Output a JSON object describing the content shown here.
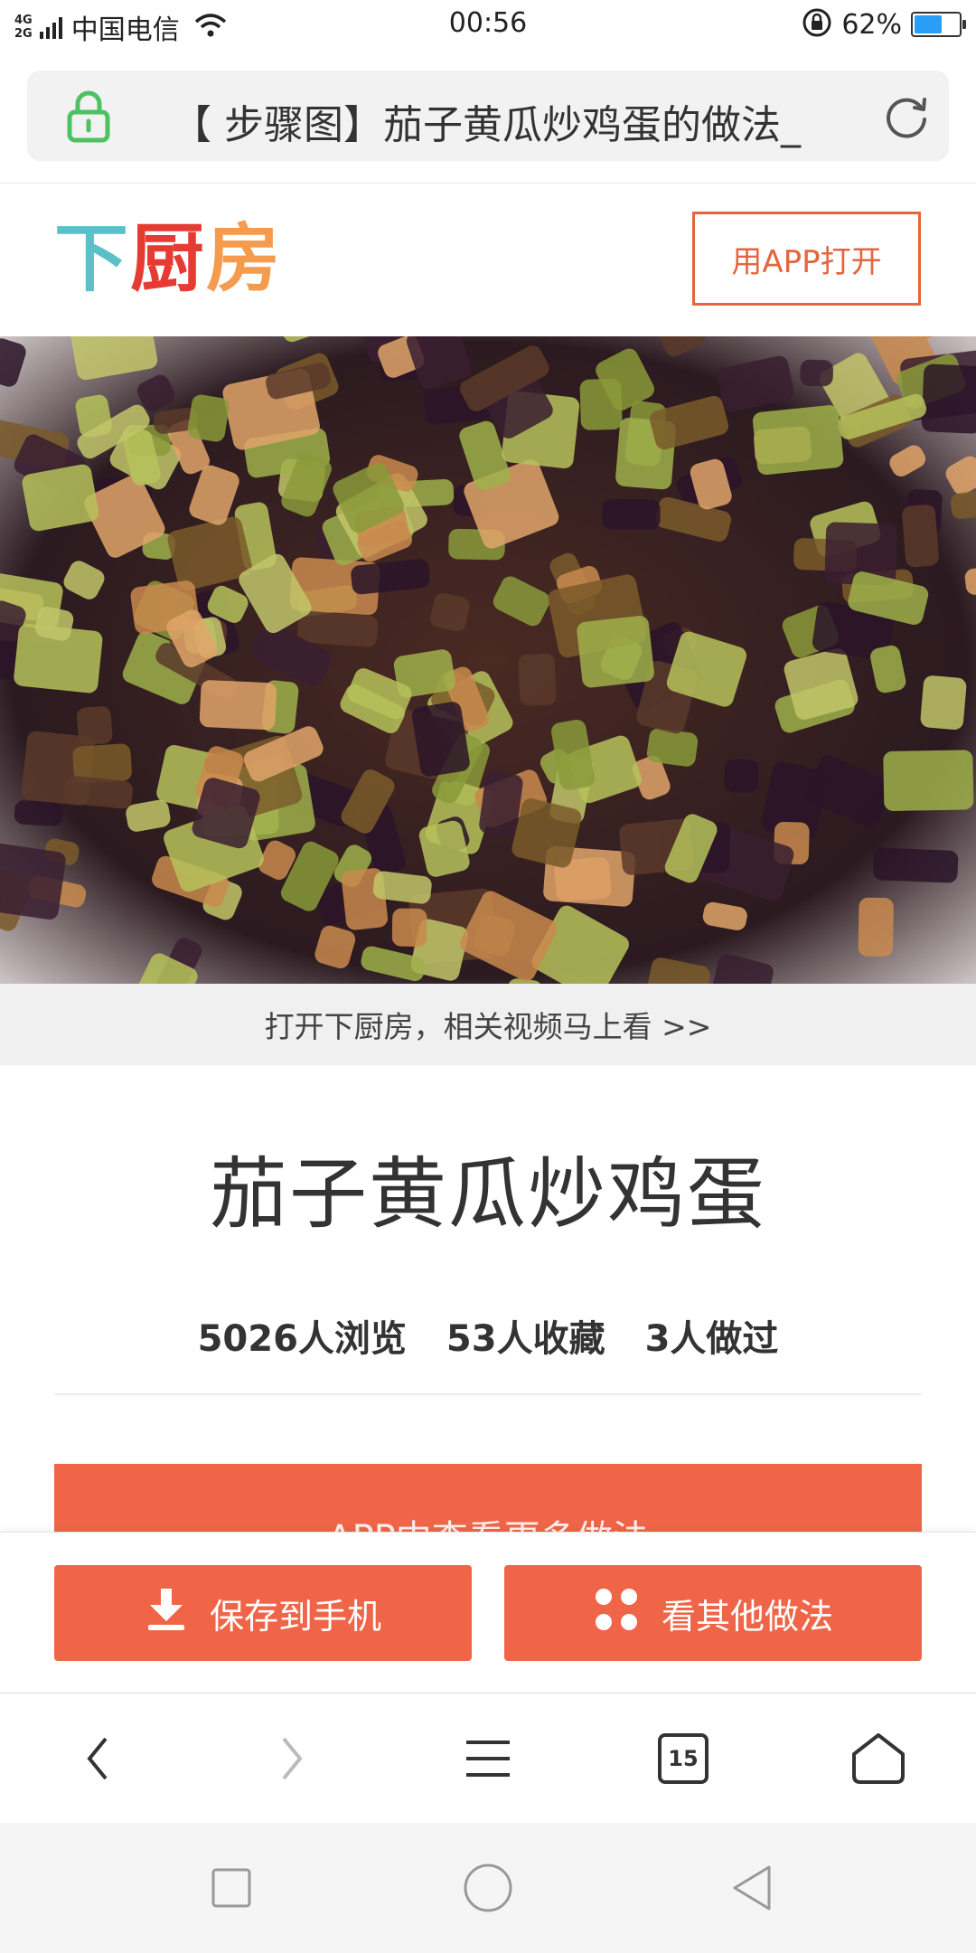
{
  "status_bar": {
    "network_top": "4G",
    "network_bottom": "2G",
    "carrier": "中国电信",
    "time": "00:56",
    "battery_percent": "62%",
    "battery_level": 0.62
  },
  "url_bar": {
    "title": "【 步骤图】茄子黄瓜炒鸡蛋的做法_"
  },
  "header": {
    "logo": {
      "part1": "下",
      "part2": "厨",
      "part3": "房"
    },
    "open_app_label": "用APP打开"
  },
  "hero": {
    "video_banner": "打开下厨房，相关视频马上看 >>"
  },
  "recipe": {
    "title": "茄子黄瓜炒鸡蛋",
    "stats": {
      "views": "5026人浏览",
      "favorites": "53人收藏",
      "cooked": "3人做过"
    },
    "more_methods_label": "APP中查看更多做法"
  },
  "action_bar": {
    "save_label": "保存到手机",
    "other_label": "看其他做法"
  },
  "browser_nav": {
    "tab_count": "15"
  },
  "colors": {
    "accent": "#f06548",
    "logo_teal": "#5cc0c8",
    "logo_red": "#e63b32",
    "logo_orange": "#f59b4e",
    "lock_green": "#4cc263"
  }
}
